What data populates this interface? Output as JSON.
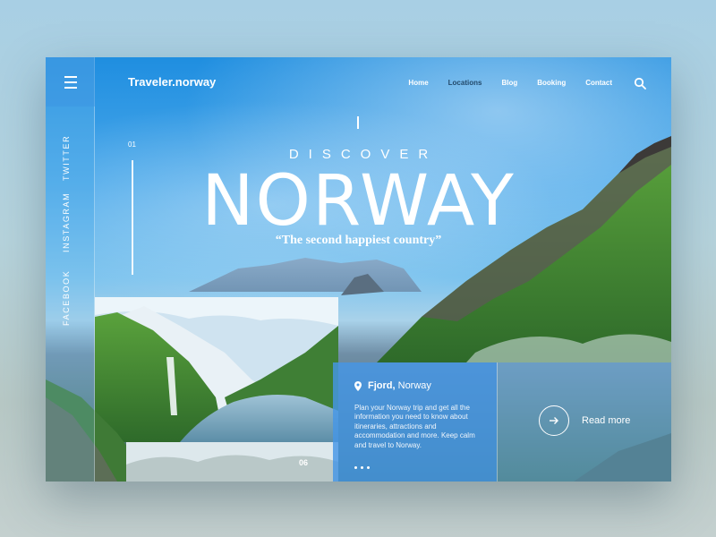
{
  "brand": {
    "logo": "Traveler.norway"
  },
  "nav": {
    "items": [
      {
        "label": "Home",
        "active": false
      },
      {
        "label": "Locations",
        "active": true
      },
      {
        "label": "Blog",
        "active": false
      },
      {
        "label": "Booking",
        "active": false
      },
      {
        "label": "Contact",
        "active": false
      }
    ]
  },
  "sidebar": {
    "social": [
      "TWITTER",
      "INSTAGRAM",
      "FACEBOOK"
    ]
  },
  "hero": {
    "slide_number": "01",
    "overline": "DISCOVER",
    "title": "NORWAY",
    "tagline": "“The second happiest country”"
  },
  "gallery": {
    "photo_number": "06"
  },
  "card": {
    "location_bold": "Fjord,",
    "location_rest": "Norway",
    "text": "Plan your Norway trip and get all the information you need to know about itineraries, attractions and accommodation and more. Keep calm and travel to Norway."
  },
  "cta": {
    "label": "Read more",
    "icon": "arrow-right-icon"
  },
  "icons": {
    "menu": "hamburger-icon",
    "search": "search-icon",
    "location": "map-pin-icon"
  },
  "colors": {
    "accent": "#4696e6",
    "nav_active": "#234a6b",
    "text": "#ffffff"
  }
}
